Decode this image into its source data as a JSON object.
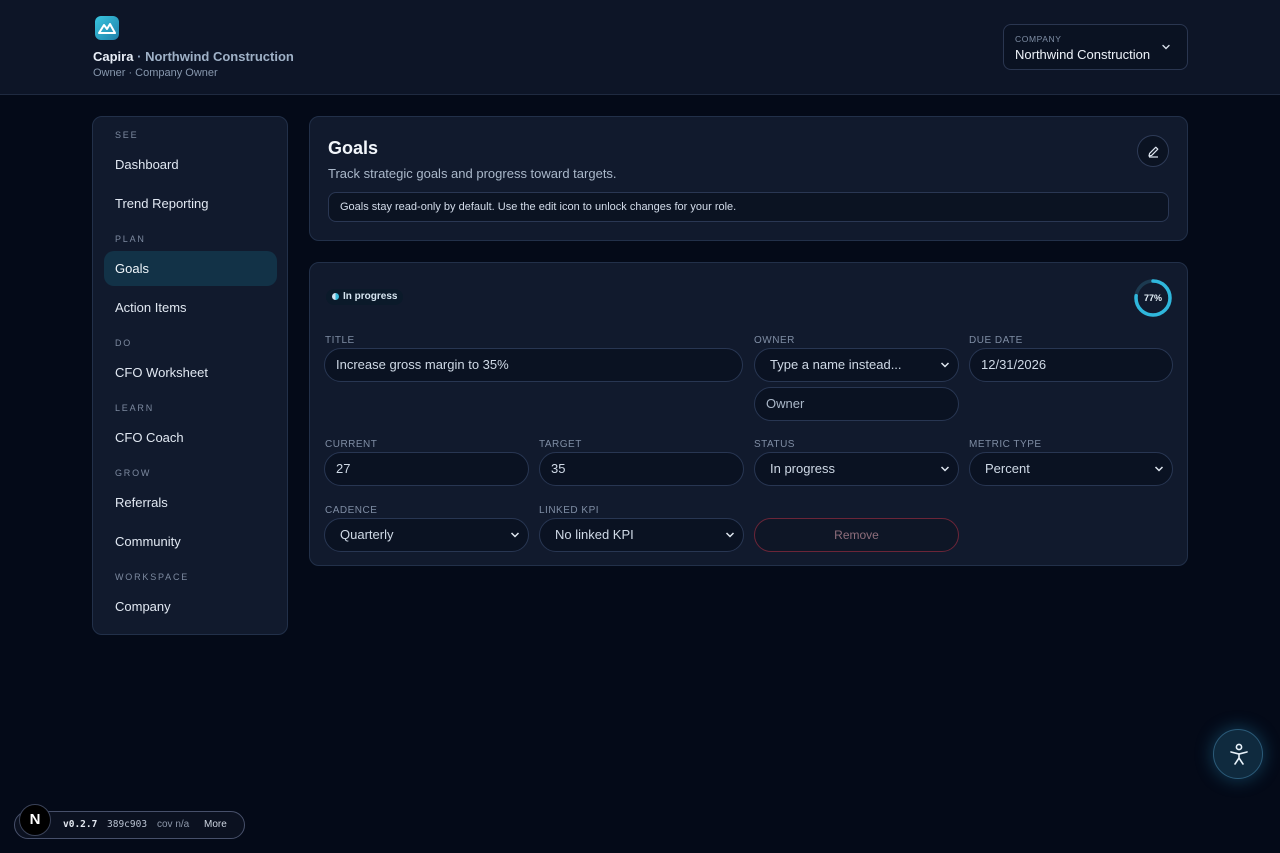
{
  "header": {
    "brand": "Capira",
    "separator": "·",
    "company_name": "Northwind Construction",
    "role": "Owner · Company Owner",
    "company_select": {
      "caption": "COMPANY",
      "value": "Northwind Construction"
    }
  },
  "sidebar": {
    "sections": [
      {
        "label": "SEE",
        "items": [
          "Dashboard",
          "Trend Reporting"
        ]
      },
      {
        "label": "PLAN",
        "items": [
          "Goals",
          "Action Items"
        ]
      },
      {
        "label": "DO",
        "items": [
          "CFO Worksheet"
        ]
      },
      {
        "label": "LEARN",
        "items": [
          "CFO Coach"
        ]
      },
      {
        "label": "GROW",
        "items": [
          "Referrals",
          "Community"
        ]
      },
      {
        "label": "WORKSPACE",
        "items": [
          "Company"
        ]
      }
    ],
    "active_item": "Goals"
  },
  "goals_header": {
    "title": "Goals",
    "subtitle": "Track strategic goals and progress toward targets.",
    "notice": "Goals stay read-only by default. Use the edit icon to unlock changes for your role."
  },
  "goal": {
    "status_badge": "In progress",
    "progress": {
      "percent": 77,
      "label": "77%"
    },
    "fields": {
      "title_label": "TITLE",
      "title_value": "Increase gross margin to 35%",
      "owner_label": "OWNER",
      "owner_select": "Type a name instead...",
      "owner_placeholder": "Owner",
      "due_date_label": "DUE DATE",
      "due_date_value": "12/31/2026",
      "current_label": "CURRENT",
      "current_value": "27",
      "target_label": "TARGET",
      "target_value": "35",
      "status_label": "STATUS",
      "status_value": "In progress",
      "metric_type_label": "METRIC TYPE",
      "metric_type_value": "Percent",
      "cadence_label": "CADENCE",
      "cadence_value": "Quarterly",
      "linked_kpi_label": "LINKED KPI",
      "linked_kpi_value": "No linked KPI"
    },
    "remove_label": "Remove"
  },
  "devbar": {
    "badge": "N",
    "version": "v0.2.7",
    "hash": "389c903",
    "coverage": "cov n/a",
    "more": "More"
  },
  "colors": {
    "accent": "#2fb7dc",
    "active_nav": "#123247",
    "danger_border": "#6b2538"
  },
  "icons": {
    "logo": "mountain-logo-icon",
    "edit": "pencil-icon",
    "fab": "accessibility-icon",
    "chevron": "chevron-down-icon"
  }
}
